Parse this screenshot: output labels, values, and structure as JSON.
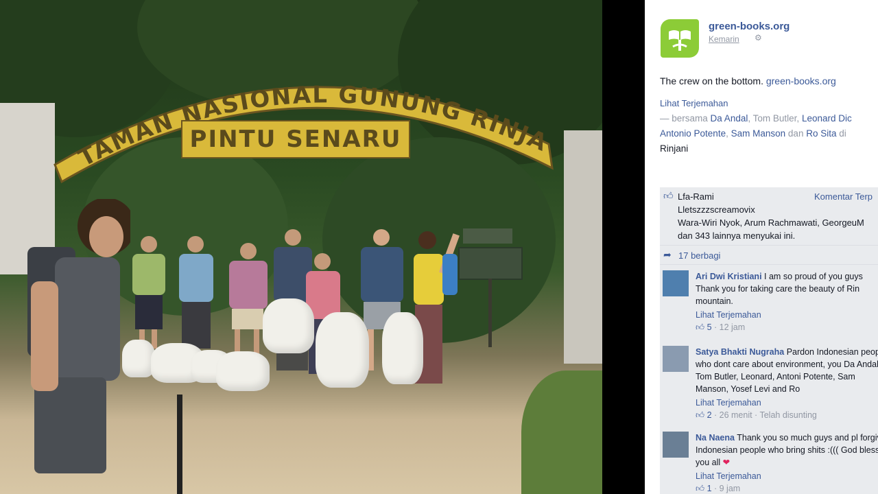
{
  "photo": {
    "arch_sign_text": "TAMAN NASIONAL GUNUNG RINJANI",
    "gate_sign_text": "PINTU SENARU"
  },
  "post": {
    "page_name": "green-books.org",
    "time": "Kemarin",
    "caption_text": "The crew on the bottom.",
    "caption_link": "green-books.org",
    "see_translation": "Lihat Terjemahan",
    "tag_prefix": "— bersama",
    "tagged": [
      "Da Andal",
      "Tom Butler",
      "Leonard Dic",
      "Antonio Potente",
      "Sam Manson",
      "Ro Sita"
    ],
    "tag_and": "dan",
    "tag_at": "di",
    "location_tail": "Rinjani"
  },
  "feedback": {
    "like_names_line1": "Lfa-Rami",
    "like_names_line2": "Lletszzzscreamovix",
    "like_names_line3": "Wara-Wiri Nyok, Arum Rachmawati, GeorgeuM",
    "like_names_line4": "dan 343 lainnya menyukai ini.",
    "comment_link": "Komentar Terp",
    "shares": "17 berbagi"
  },
  "comments": [
    {
      "name": "Ari Dwi Kristiani",
      "text": "I am so proud of you guys Thank you for taking care the beauty of Rin mountain.",
      "translate": "Lihat Terjemahan",
      "likes": "5",
      "time": "12 jam"
    },
    {
      "name": "Satya Bhakti Nugraha",
      "text": "Pardon Indonesian people who dont care about environment, you Da Andal, Tom Butler, Leonard, Antoni Potente, Sam Manson, Yosef Levi and Ro",
      "translate": "Lihat Terjemahan",
      "likes": "2",
      "time": "26 menit",
      "edited": "Telah disunting"
    },
    {
      "name": "Na Naena",
      "text": "Thank you so much guys and pl forgive Indonesian people who bring shits :((( God bless you all",
      "translate": "Lihat Terjemahan",
      "likes": "1",
      "time": "9 jam"
    }
  ],
  "colors": {
    "fb_blue": "#3b5998",
    "logo_green": "#8ccc37",
    "sign_yellow": "#d9b93a"
  }
}
